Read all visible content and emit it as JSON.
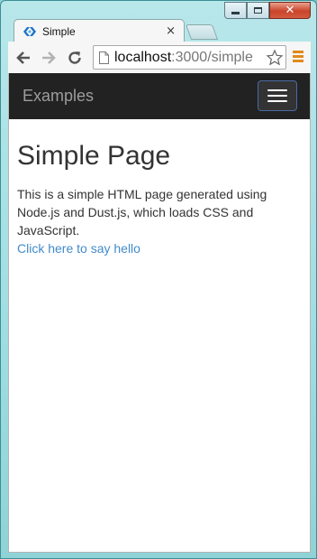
{
  "browser": {
    "tab_title": "Simple",
    "tab_close": "×",
    "url_host": "localhost",
    "url_path": ":3000/simple",
    "window_controls": [
      "minimize",
      "maximize",
      "close"
    ]
  },
  "navbar": {
    "brand": "Examples",
    "toggle_icon": "hamburger-icon"
  },
  "page": {
    "heading": "Simple Page",
    "description": "This is a simple HTML page generated using Node.js and Dust.js, which loads CSS and JavaScript.",
    "link_text": "Click here to say hello"
  },
  "colors": {
    "navbar_bg": "#222222",
    "brand": "#9d9d9d",
    "link": "#428bca",
    "menu_accent": "#e08a19"
  }
}
